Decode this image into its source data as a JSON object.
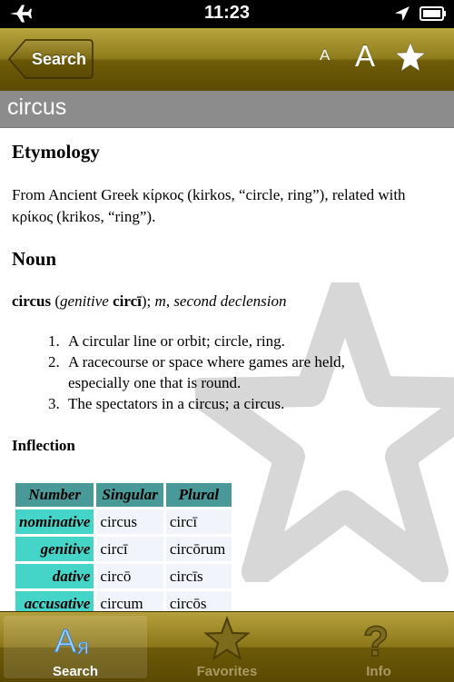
{
  "status_bar": {
    "time": "11:23",
    "icons": [
      "airplane-icon",
      "location-arrow-icon",
      "battery-icon"
    ]
  },
  "nav": {
    "back_label": "Search",
    "font_small_label": "A",
    "font_large_label": "A",
    "favorite_icon": "star-icon"
  },
  "entry": {
    "word": "circus",
    "etymology_heading": "Etymology",
    "etymology_text": "From Ancient Greek κίρκος (kirkos, “circle, ring”), related with κρίκος (krikos, “ring”).",
    "pos_heading": "Noun",
    "headword": "circus",
    "headword_grammar_open": " (",
    "genitive_label": "genitive",
    "genitive_form": "circī",
    "headword_grammar_mid": "); ",
    "gender": "m",
    "gender_sep": ", ",
    "declension": "second declension",
    "senses": [
      {
        "num": "1.",
        "text": "A circular line or orbit; circle, ring."
      },
      {
        "num": "2.",
        "text": "A racecourse or space where games are held, especially one that is round."
      },
      {
        "num": "3.",
        "text": "The spectators in a circus; a circus."
      }
    ],
    "inflection_heading": "Inflection",
    "inflection_table": {
      "headers": [
        "Number",
        "Singular",
        "Plural"
      ],
      "rows": [
        {
          "case": "nominative",
          "singular": "circus",
          "plural": "circī"
        },
        {
          "case": "genitive",
          "singular": "circī",
          "plural": "circōrum"
        },
        {
          "case": "dative",
          "singular": "circō",
          "plural": "circīs"
        },
        {
          "case": "accusative",
          "singular": "circum",
          "plural": "circōs"
        }
      ]
    }
  },
  "tabs": [
    {
      "label": "Search",
      "icon": "alphabet-search-icon",
      "selected": true
    },
    {
      "label": "Favorites",
      "icon": "star-outline-icon",
      "selected": false
    },
    {
      "label": "Info",
      "icon": "question-mark-icon",
      "selected": false
    }
  ],
  "colors": {
    "nav_gold": "#8f7c1c",
    "title_gray": "#8c8c8c",
    "table_header": "#4a9999",
    "table_case": "#44d4c8"
  }
}
